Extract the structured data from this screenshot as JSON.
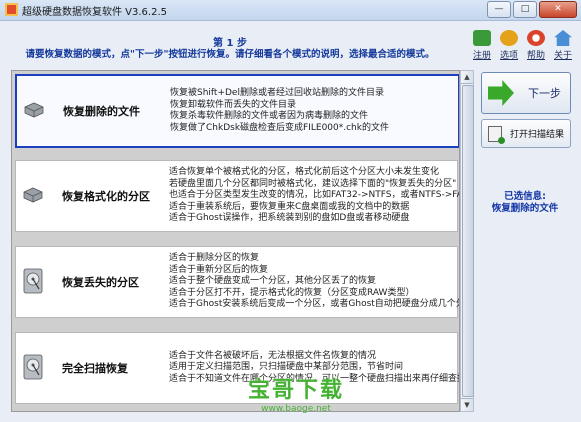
{
  "window": {
    "title": "超级硬盘数据恢复软件 V3.6.2.5",
    "controls": {
      "minimize": "—",
      "maximize": "□",
      "close": "✕"
    }
  },
  "header": {
    "step": "第 1 步",
    "instruction": "请要恢复数据的模式，点\"下一步\"按钮进行恢复。请仔细看各个模式的说明，选择最合适的模式。"
  },
  "toolbar": [
    {
      "label": "注册",
      "icon": "register-cart-icon",
      "color": "#3a9a3a"
    },
    {
      "label": "选项",
      "icon": "options-gear-icon",
      "color": "#e3a21a"
    },
    {
      "label": "帮助",
      "icon": "help-lifebuoy-icon",
      "color": "#d9442b"
    },
    {
      "label": "关于",
      "icon": "about-home-icon",
      "color": "#4a8fd6"
    }
  ],
  "modes": [
    {
      "name": "恢复删除的文件",
      "icon": "hard-disk-icon",
      "selected": true,
      "desc": [
        "恢复被Shift+Del删除或者经过回收站删除的文件目录",
        "恢复卸载软件而丢失的文件目录",
        "恢复杀毒软件删除的文件或者因为病毒删除的文件",
        "恢复做了ChkDsk磁盘检查后变成FILE000*.chk的文件"
      ]
    },
    {
      "name": "恢复格式化的分区",
      "icon": "hard-disk-icon",
      "selected": false,
      "desc": [
        "适合恢复单个被格式化的分区，格式化前后这个分区大小未发生变化",
        "若硬盘里面几个分区都同时被格式化，建议选择下面的\"恢复丢失的分区\"",
        "也适合于分区类型发生改变的情况，比如FAT32->NTFS，或者NTFS->FAT3",
        "适合于重装系统后，要恢复重来C盘桌面或我的文档中的数据",
        "适合于Ghost误操作，把系统装到别的盘如D盘或者移动硬盘"
      ]
    },
    {
      "name": "恢复丢失的分区",
      "icon": "open-disk-icon",
      "selected": false,
      "desc": [
        "适合于删除分区的恢复",
        "适合于重新分区后的恢复",
        "适合于整个硬盘变成一个分区，其他分区丢了的恢复",
        "适合于分区打不开，提示格式化的恢复（分区变成RAW类型）",
        "适合于Ghost安装系统后变成一个分区，或者Ghost自动把硬盘分成几个分"
      ]
    },
    {
      "name": "完全扫描恢复",
      "icon": "open-disk-icon",
      "selected": false,
      "desc": [
        "适合于文件名被破坏后，无法根据文件名恢复的情况",
        "适用于定义扫描范围，只扫描硬盘中某部分范围，节省时间",
        "适合于不知道文件在哪个分区的情况，可以一整个硬盘扫描出来再仔细查找文件"
      ]
    }
  ],
  "buttons": {
    "next": "下一步",
    "open_scan": "打开扫描结果"
  },
  "selection": {
    "label": "已选信息:",
    "value": "恢复删除的文件"
  },
  "watermark": {
    "brand": "宝哥下载",
    "url": "www.baoge.net"
  },
  "colors": {
    "accent": "#1538a7",
    "selected_border": "#1b3fbf",
    "next_arrow": "#3aa82a"
  }
}
